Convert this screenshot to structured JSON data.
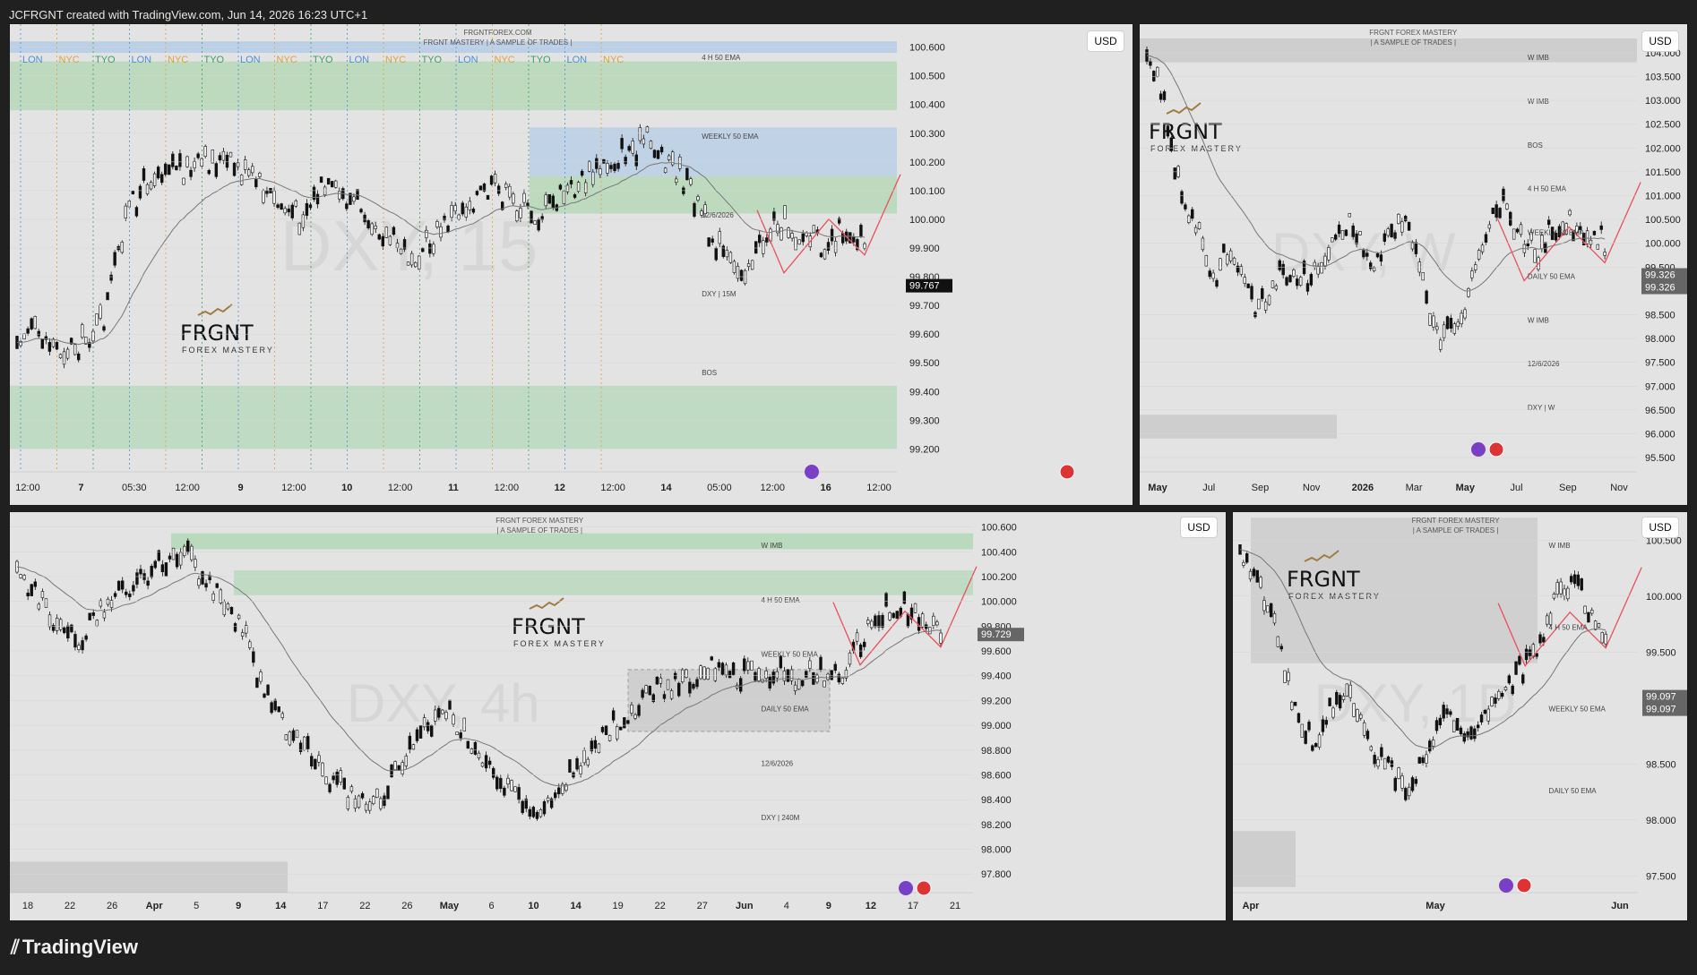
{
  "header": {
    "credit": "JCFRGNT created with TradingView.com, Jun 14, 2026 16:23 UTC+1"
  },
  "footer": {
    "brand": "TradingView"
  },
  "colors": {
    "bg": "#202020",
    "pane": "#e3e3e3",
    "candle": "#111111",
    "green": "#9ed3a3",
    "blue": "#a9c7e8",
    "red": "#e8505b",
    "darkgreen": "#2e7d32"
  },
  "panes": [
    {
      "id": "p15m",
      "currency": "USD",
      "watermark": "DXY, 15",
      "top_text": [
        "FRGNTFOREX.COM",
        "FRGNT MASTERY | A SAMPLE OF TRADES |"
      ],
      "ylim": [
        99.12,
        100.68
      ],
      "y_ticks": [
        "100.600",
        "100.500",
        "100.400",
        "100.300",
        "100.200",
        "100.100",
        "100.000",
        "99.900",
        "99.800",
        "99.700",
        "99.600",
        "99.500",
        "99.400",
        "99.300",
        "99.200"
      ],
      "x_ticks": [
        "12:00",
        "7",
        "05:30",
        "12:00",
        "9",
        "12:00",
        "10",
        "12:00",
        "11",
        "12:00",
        "12",
        "12:00",
        "14",
        "05:00",
        "12:00",
        "16",
        "12:00"
      ],
      "sessions": [
        "LON",
        "NYC",
        "TYO",
        "LON",
        "NYC",
        "TYO",
        "LON",
        "NYC",
        "TYO",
        "LON",
        "NYC",
        "TYO",
        "LON",
        "NYC",
        "TYO",
        "LON",
        "NYC"
      ],
      "price_label": "99.767",
      "annotations": [
        "4 H 50 EMA",
        "WEEKLY 50 EMA",
        "12/6/2026",
        "DXY | 15M",
        "BOS"
      ],
      "logo": {
        "title": "FRGNT",
        "sub": "FOREX MASTERY"
      }
    },
    {
      "id": "pW",
      "currency": "USD",
      "watermark": "DXY, W",
      "top_text": [
        "FRGNT FOREX MASTERY",
        "| A SAMPLE OF TRADES |"
      ],
      "ylim": [
        95.2,
        104.6
      ],
      "y_ticks": [
        "104.000",
        "103.500",
        "103.000",
        "102.500",
        "102.000",
        "101.500",
        "101.000",
        "100.500",
        "100.000",
        "99.500",
        "98.500",
        "98.000",
        "97.500",
        "97.000",
        "96.500",
        "96.000",
        "95.500"
      ],
      "x_ticks": [
        "May",
        "Jul",
        "Sep",
        "Nov",
        "2026",
        "Mar",
        "May",
        "Jul",
        "Sep",
        "Nov"
      ],
      "price_labels": [
        "99.326",
        "99.326"
      ],
      "annotations": [
        "W IMB",
        "W IMB",
        "BOS",
        "4 H 50 EMA",
        "WEEKLY 50 EMA",
        "DAILY 50 EMA",
        "W IMB",
        "12/6/2026",
        "DXY | W"
      ],
      "logo": {
        "title": "FRGNT",
        "sub": "FOREX MASTERY"
      }
    },
    {
      "id": "p4h",
      "currency": "USD",
      "watermark": "DXY, 4h",
      "top_text": [
        "FRGNT FOREX MASTERY",
        "| A SAMPLE OF TRADES |"
      ],
      "ylim": [
        97.65,
        100.72
      ],
      "y_ticks": [
        "100.600",
        "100.400",
        "100.200",
        "100.000",
        "99.800",
        "99.600",
        "99.400",
        "99.200",
        "99.000",
        "98.800",
        "98.600",
        "98.400",
        "98.200",
        "98.000",
        "97.800"
      ],
      "x_ticks": [
        "18",
        "22",
        "26",
        "Apr",
        "5",
        "9",
        "14",
        "17",
        "22",
        "26",
        "May",
        "6",
        "10",
        "14",
        "19",
        "22",
        "27",
        "Jun",
        "4",
        "9",
        "12",
        "17",
        "21"
      ],
      "price_label": "99.729",
      "annotations": [
        "W IMB",
        "4 H 50 EMA",
        "WEEKLY 50 EMA",
        "DAILY 50 EMA",
        "12/6/2026",
        "DXY | 240M"
      ],
      "logo": {
        "title": "FRGNT",
        "sub": "FOREX MASTERY"
      }
    },
    {
      "id": "pD",
      "currency": "USD",
      "watermark": "DXY, 1D",
      "top_text": [
        "FRGNT FOREX MASTERY",
        "| A SAMPLE OF TRADES |"
      ],
      "ylim": [
        97.35,
        100.75
      ],
      "y_ticks": [
        "100.500",
        "100.000",
        "99.500",
        "98.500",
        "98.000",
        "97.500"
      ],
      "x_ticks": [
        "Apr",
        "May",
        "Jun"
      ],
      "price_labels": [
        "99.097",
        "99.097"
      ],
      "annotations": [
        "W IMB",
        "4 H 50 EMA",
        "WEEKLY 50 EMA",
        "DAILY 50 EMA"
      ],
      "logo": {
        "title": "FRGNT",
        "sub": "FOREX MASTERY"
      }
    }
  ]
}
